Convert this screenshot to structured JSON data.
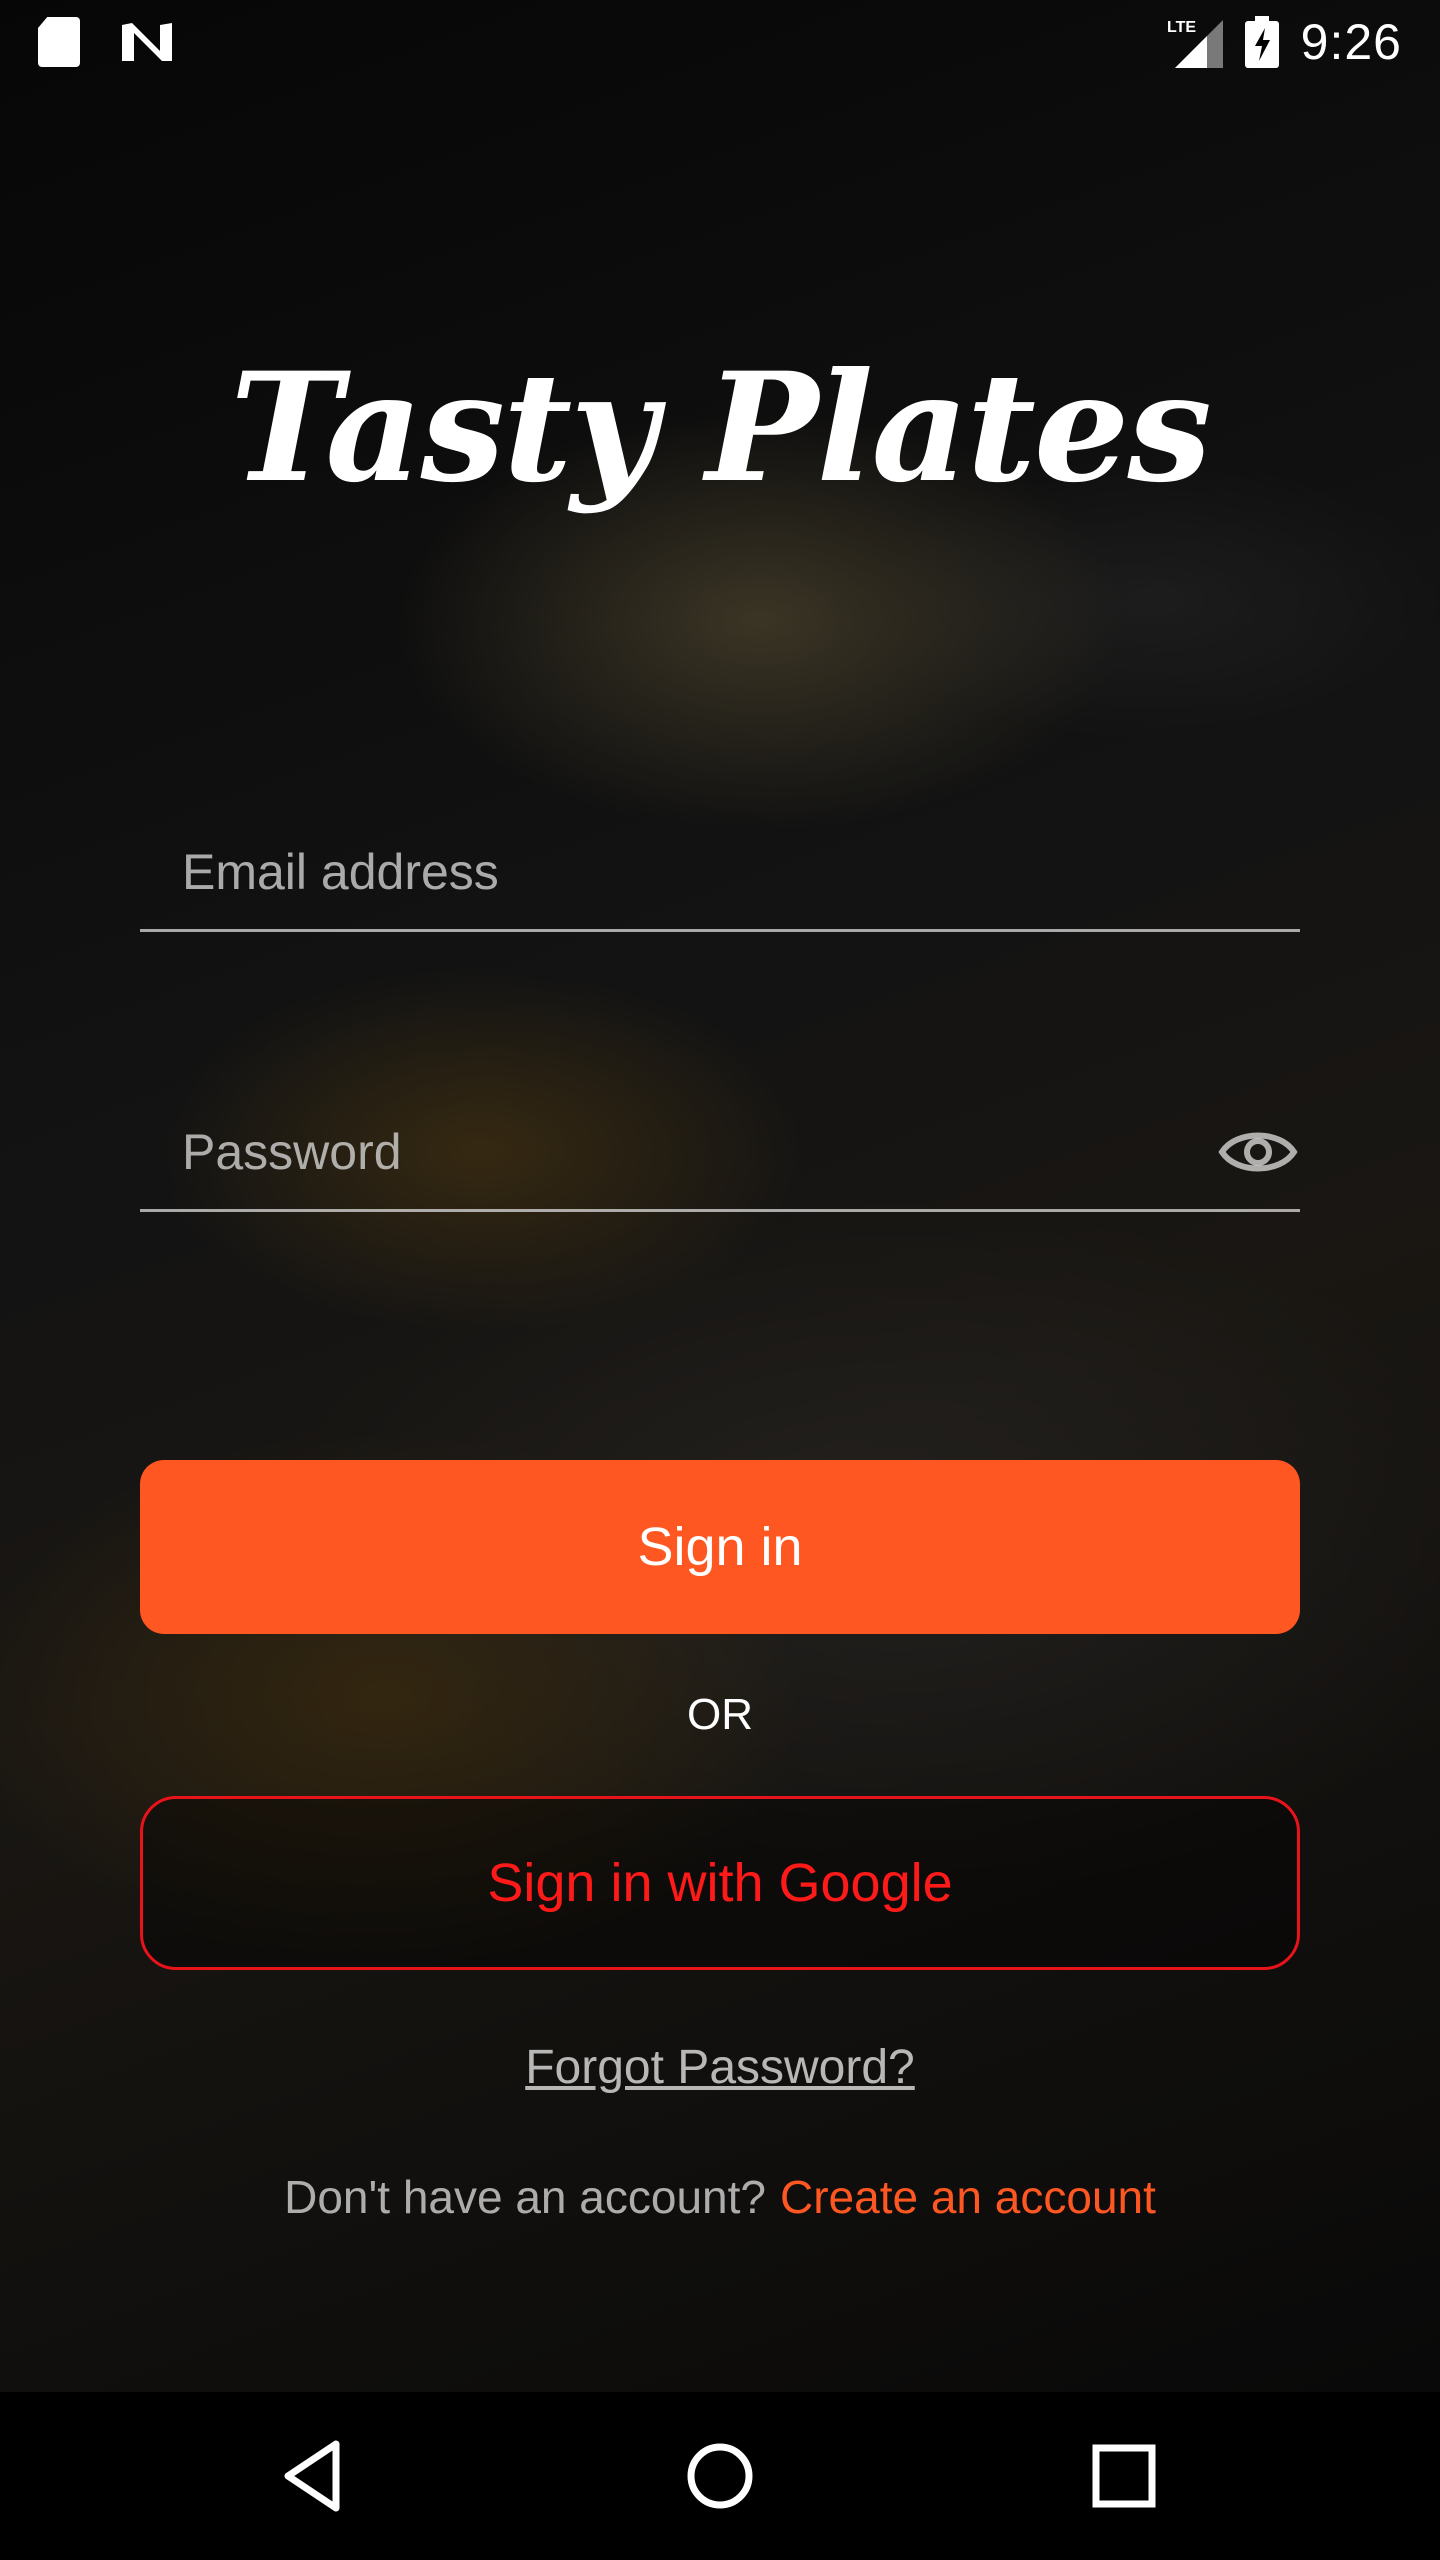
{
  "status_bar": {
    "time": "9:26",
    "network": "LTE",
    "icons": [
      "sd-card-icon",
      "n-notification-icon",
      "lte-signal-icon",
      "battery-charging-icon"
    ]
  },
  "app": {
    "title": "Tasty Plates"
  },
  "form": {
    "email_placeholder": "Email address",
    "password_placeholder": "Password",
    "password_toggle_icon": "eye-icon"
  },
  "actions": {
    "sign_in_label": "Sign in",
    "or_label": "OR",
    "google_label": "Sign in with Google",
    "forgot_label": "Forgot Password?",
    "signup_prompt": "Don't have an account?",
    "create_account_label": "Create an account"
  },
  "colors": {
    "accent": "#ff5722",
    "google_red": "#e8131b"
  },
  "nav_bar": {
    "icons": [
      "back-icon",
      "home-icon",
      "recents-icon"
    ]
  }
}
